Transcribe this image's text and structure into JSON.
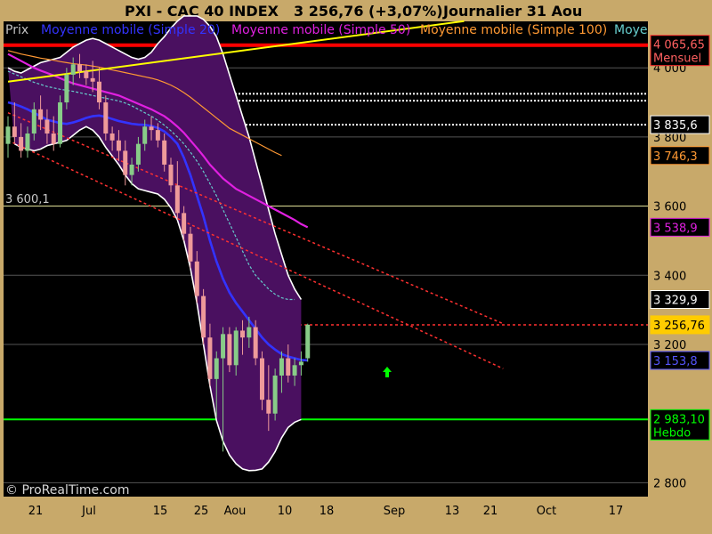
{
  "window": {
    "title_left": "PXI - CAC 40 INDEX",
    "title_value": "3 256,76 (+3,07%)",
    "title_period": "Journalier  31 Aou"
  },
  "legend": [
    {
      "label": "Prix",
      "color": "#c0c0c0"
    },
    {
      "label": "Moyenne mobile (Simple 20)",
      "color": "#3333ff"
    },
    {
      "label": "Moyenne mobile (Simple 50)",
      "color": "#e020e0"
    },
    {
      "label": "Moyenne mobile (Simple 100)",
      "color": "#ff9933"
    },
    {
      "label": "Moye",
      "color": "#66cccc"
    }
  ],
  "watermark": "© ProRealTime.com",
  "level_label": "3 600,1",
  "badges": [
    {
      "label": "4 065,65",
      "sub": "Mensuel",
      "value": 4065.65,
      "bg": "#000000",
      "fg": "#ff6060",
      "border": "#ff3030"
    },
    {
      "label": "3 835,6",
      "value": 3835.6,
      "bg": "#000000",
      "fg": "#ffffff",
      "border": "#ffffff"
    },
    {
      "label": "3 746,3",
      "value": 3746.3,
      "bg": "#000000",
      "fg": "#ff9933",
      "border": "#ff9933"
    },
    {
      "label": "3 538,9",
      "value": 3538.9,
      "bg": "#000000",
      "fg": "#e020e0",
      "border": "#e020e0"
    },
    {
      "label": "3 329,9",
      "value": 3329.9,
      "bg": "#000000",
      "fg": "#ffffff",
      "border": "#ffffff"
    },
    {
      "label": "3 256,76",
      "value": 3256.76,
      "bg": "#ffcc00",
      "fg": "#000000",
      "border": "#ffcc00"
    },
    {
      "label": "3 153,8",
      "value": 3153.8,
      "bg": "#000000",
      "fg": "#5555ff",
      "border": "#5555ff"
    },
    {
      "label": "2 983,10",
      "sub": "Hebdo",
      "value": 2983.1,
      "bg": "#000000",
      "fg": "#00ff00",
      "border": "#00ff00"
    }
  ],
  "colors": {
    "background": "#000000",
    "frame": "#c8a96a",
    "bollinger_fill": "#4a1060",
    "bollinger_line": "#ffffff",
    "candle_up": "#88cc88",
    "candle_down": "#ee9a9a",
    "resistance_red": "#ff0000",
    "support_green": "#00ff00",
    "trend_yellow": "#ffff00",
    "dashed_red": "#ff3030",
    "dotted_white": "#ffffff",
    "level_line": "#d8d890",
    "gridline": "#555555"
  },
  "chart_data": {
    "type": "candlestick",
    "title": "PXI - CAC 40 INDEX",
    "ylim": [
      2780,
      4150
    ],
    "y_ticks": [
      {
        "value": 4000,
        "label": "4 000"
      },
      {
        "value": 3800,
        "label": "3 800"
      },
      {
        "value": 3600,
        "label": "3 600"
      },
      {
        "value": 3400,
        "label": "3 400"
      },
      {
        "value": 3200,
        "label": "3 200"
      },
      {
        "value": 2800,
        "label": "2 800"
      }
    ],
    "x_ticks": [
      {
        "index": 3,
        "label": "21"
      },
      {
        "index": 10,
        "label": "Jul"
      },
      {
        "index": 18,
        "label": "15"
      },
      {
        "index": 22,
        "label": "25"
      },
      {
        "index": 26,
        "label": "Aou"
      },
      {
        "index": 33,
        "label": "10"
      },
      {
        "index": 39,
        "label": "18"
      },
      {
        "index": 45,
        "label": "Sep"
      },
      {
        "index": 53,
        "label": "13"
      },
      {
        "index": 58,
        "label": "21"
      },
      {
        "index": 65,
        "label": "Oct"
      },
      {
        "index": 74,
        "label": "17"
      }
    ],
    "x_range": [
      0,
      77
    ],
    "candles": [
      {
        "o": 3780,
        "h": 3860,
        "l": 3740,
        "c": 3830
      },
      {
        "o": 3830,
        "h": 3900,
        "l": 3780,
        "c": 3800
      },
      {
        "o": 3800,
        "h": 3840,
        "l": 3740,
        "c": 3760
      },
      {
        "o": 3760,
        "h": 3830,
        "l": 3740,
        "c": 3810
      },
      {
        "o": 3810,
        "h": 3900,
        "l": 3790,
        "c": 3880
      },
      {
        "o": 3880,
        "h": 3920,
        "l": 3820,
        "c": 3850
      },
      {
        "o": 3850,
        "h": 3880,
        "l": 3780,
        "c": 3810
      },
      {
        "o": 3810,
        "h": 3860,
        "l": 3760,
        "c": 3780
      },
      {
        "o": 3780,
        "h": 3920,
        "l": 3770,
        "c": 3900
      },
      {
        "o": 3900,
        "h": 4000,
        "l": 3880,
        "c": 3980
      },
      {
        "o": 3980,
        "h": 4030,
        "l": 3950,
        "c": 4010
      },
      {
        "o": 4010,
        "h": 4040,
        "l": 3970,
        "c": 3990
      },
      {
        "o": 3990,
        "h": 4010,
        "l": 3950,
        "c": 3970
      },
      {
        "o": 3970,
        "h": 4020,
        "l": 3930,
        "c": 3960
      },
      {
        "o": 3960,
        "h": 4000,
        "l": 3880,
        "c": 3900
      },
      {
        "o": 3900,
        "h": 3920,
        "l": 3790,
        "c": 3810
      },
      {
        "o": 3810,
        "h": 3830,
        "l": 3760,
        "c": 3790
      },
      {
        "o": 3790,
        "h": 3820,
        "l": 3730,
        "c": 3760
      },
      {
        "o": 3760,
        "h": 3790,
        "l": 3660,
        "c": 3690
      },
      {
        "o": 3690,
        "h": 3740,
        "l": 3660,
        "c": 3720
      },
      {
        "o": 3720,
        "h": 3800,
        "l": 3700,
        "c": 3780
      },
      {
        "o": 3780,
        "h": 3850,
        "l": 3760,
        "c": 3830
      },
      {
        "o": 3830,
        "h": 3860,
        "l": 3790,
        "c": 3820
      },
      {
        "o": 3820,
        "h": 3840,
        "l": 3770,
        "c": 3790
      },
      {
        "o": 3790,
        "h": 3810,
        "l": 3700,
        "c": 3720
      },
      {
        "o": 3720,
        "h": 3740,
        "l": 3640,
        "c": 3660
      },
      {
        "o": 3660,
        "h": 3730,
        "l": 3560,
        "c": 3580
      },
      {
        "o": 3580,
        "h": 3600,
        "l": 3500,
        "c": 3520
      },
      {
        "o": 3520,
        "h": 3540,
        "l": 3420,
        "c": 3440
      },
      {
        "o": 3440,
        "h": 3470,
        "l": 3320,
        "c": 3340
      },
      {
        "o": 3340,
        "h": 3360,
        "l": 3200,
        "c": 3220
      },
      {
        "o": 3220,
        "h": 3260,
        "l": 3080,
        "c": 3100
      },
      {
        "o": 3100,
        "h": 3180,
        "l": 2990,
        "c": 3160
      },
      {
        "o": 3160,
        "h": 3250,
        "l": 2890,
        "c": 3230
      },
      {
        "o": 3230,
        "h": 3250,
        "l": 3120,
        "c": 3140
      },
      {
        "o": 3140,
        "h": 3250,
        "l": 3110,
        "c": 3240
      },
      {
        "o": 3240,
        "h": 3270,
        "l": 3170,
        "c": 3220
      },
      {
        "o": 3220,
        "h": 3280,
        "l": 3190,
        "c": 3250
      },
      {
        "o": 3250,
        "h": 3270,
        "l": 3140,
        "c": 3160
      },
      {
        "o": 3160,
        "h": 3180,
        "l": 3010,
        "c": 3040
      },
      {
        "o": 3040,
        "h": 3140,
        "l": 2950,
        "c": 3000
      },
      {
        "o": 3000,
        "h": 3130,
        "l": 2980,
        "c": 3110
      },
      {
        "o": 3110,
        "h": 3180,
        "l": 3060,
        "c": 3160
      },
      {
        "o": 3160,
        "h": 3200,
        "l": 3090,
        "c": 3110
      },
      {
        "o": 3110,
        "h": 3160,
        "l": 3080,
        "c": 3140
      },
      {
        "o": 3140,
        "h": 3180,
        "l": 3110,
        "c": 3150
      },
      {
        "o": 3160,
        "h": 3260,
        "l": 3150,
        "c": 3257
      }
    ],
    "sma20": [
      3900,
      3895,
      3888,
      3880,
      3870,
      3860,
      3850,
      3845,
      3840,
      3838,
      3842,
      3848,
      3855,
      3860,
      3862,
      3858,
      3852,
      3846,
      3842,
      3838,
      3836,
      3835,
      3832,
      3826,
      3816,
      3800,
      3780,
      3740,
      3690,
      3630,
      3570,
      3500,
      3440,
      3390,
      3350,
      3320,
      3295,
      3270,
      3245,
      3220,
      3200,
      3185,
      3172,
      3165,
      3160,
      3155,
      3153.8
    ],
    "sma50": [
      4040,
      4030,
      4020,
      4010,
      4000,
      3992,
      3985,
      3978,
      3970,
      3962,
      3955,
      3950,
      3945,
      3940,
      3935,
      3930,
      3925,
      3920,
      3912,
      3904,
      3896,
      3888,
      3880,
      3870,
      3860,
      3846,
      3830,
      3812,
      3790,
      3768,
      3745,
      3720,
      3700,
      3680,
      3665,
      3650,
      3640,
      3630,
      3620,
      3610,
      3600,
      3590,
      3580,
      3570,
      3560,
      3548,
      3538.9
    ],
    "sma100": [
      4050,
      4045,
      4040,
      4036,
      4032,
      4028,
      4025,
      4022,
      4018,
      4015,
      4012,
      4010,
      4008,
      4005,
      4002,
      3998,
      3994,
      3990,
      3986,
      3982,
      3978,
      3974,
      3970,
      3965,
      3958,
      3950,
      3940,
      3928,
      3915,
      3900,
      3885,
      3870,
      3855,
      3840,
      3825,
      3815,
      3805,
      3795,
      3785,
      3775,
      3765,
      3755,
      3746.3
    ],
    "sma200": [
      3990,
      3982,
      3974,
      3966,
      3958,
      3952,
      3946,
      3942,
      3938,
      3935,
      3932,
      3928,
      3924,
      3920,
      3916,
      3912,
      3908,
      3904,
      3898,
      3890,
      3880,
      3870,
      3860,
      3848,
      3834,
      3818,
      3800,
      3780,
      3756,
      3730,
      3700,
      3665,
      3630,
      3590,
      3550,
      3510,
      3470,
      3430,
      3400,
      3380,
      3360,
      3345,
      3335,
      3330,
      3329.9
    ],
    "bb_upper": [
      4000,
      3990,
      3985,
      3995,
      4005,
      4015,
      4020,
      4025,
      4030,
      4045,
      4060,
      4070,
      4080,
      4085,
      4080,
      4070,
      4060,
      4050,
      4040,
      4030,
      4025,
      4030,
      4045,
      4070,
      4090,
      4115,
      4135,
      4150,
      4150,
      4150,
      4140,
      4120,
      4090,
      4040,
      3980,
      3920,
      3860,
      3800,
      3730,
      3660,
      3590,
      3520,
      3460,
      3400,
      3360,
      3330
    ],
    "bb_lower": [
      3780,
      3770,
      3765,
      3760,
      3765,
      3775,
      3780,
      3785,
      3790,
      3805,
      3820,
      3830,
      3820,
      3800,
      3770,
      3745,
      3720,
      3690,
      3665,
      3650,
      3645,
      3640,
      3635,
      3620,
      3595,
      3560,
      3500,
      3420,
      3320,
      3200,
      3080,
      2980,
      2920,
      2880,
      2855,
      2840,
      2835,
      2836,
      2840,
      2860,
      2890,
      2930,
      2960,
      2975,
      2983
    ],
    "levels": {
      "monthly_resistance": 4065.65,
      "weekly_support": 2983.1,
      "horizontal_3600": 3600.1,
      "dotted_whites": [
        3925,
        3905,
        3835.6
      ],
      "last_price": 3256.76
    },
    "yellow_trend": {
      "from": [
        0,
        3960
      ],
      "to": [
        70,
        4135
      ]
    },
    "red_dashed_trends": [
      {
        "from": [
          0,
          3870
        ],
        "to": [
          76,
          3260
        ]
      },
      {
        "from": [
          0,
          3790
        ],
        "to": [
          76,
          3130
        ]
      }
    ]
  }
}
